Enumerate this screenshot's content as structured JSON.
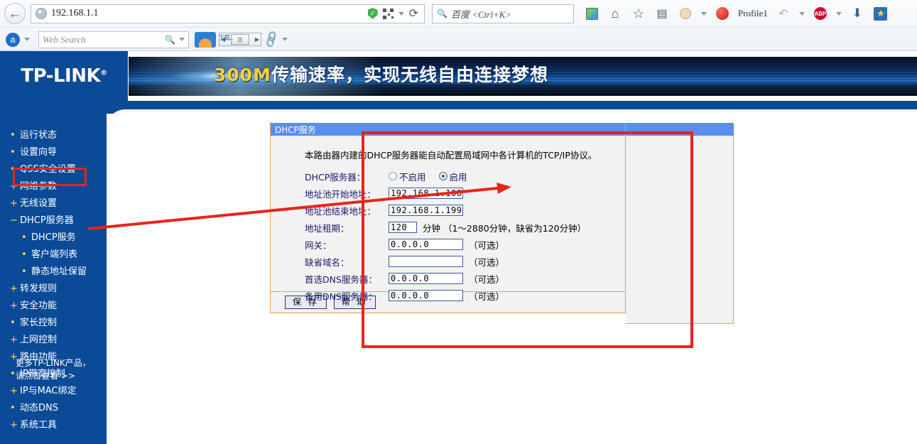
{
  "browser": {
    "back_icon": "back-arrow-icon",
    "url": "192.168.1.1",
    "url_shield_icon": "shield-check-icon",
    "url_qr_icon": "qr-code-icon",
    "url_dropdown_icon": "chevron-down-icon",
    "reload_icon": "reload-icon",
    "search_placeholder": "百度 <Ctrl+K>",
    "search_icon": "search-icon",
    "toolbar": {
      "translate_icon": "translate-icon",
      "home_icon": "home-icon",
      "bookmark_star_icon": "star-icon",
      "reading_list_icon": "document-icon",
      "avatar_icon": "face-icon",
      "overflow_caret_icon": "chevron-down-icon",
      "tomato_icon": "tomato-timer-icon",
      "profile_label": "Profile1",
      "undo_icon": "undo-icon",
      "undo_caret_icon": "chevron-down-icon",
      "adblock_label": "ABP",
      "adblock_caret_icon": "chevron-down-icon",
      "download_icon": "download-icon",
      "favorites_icon": "star-favorites-icon"
    },
    "extension_bar": {
      "alexa_label": "a",
      "alexa_caret_icon": "chevron-down-icon",
      "web_search_placeholder": "Web Search",
      "web_search_icon": "search-icon",
      "web_search_caret_icon": "chevron-down-icon",
      "mini_label": "下载...",
      "scroll_left_icon": "left-arrow-icon",
      "scroll_thumb_icon": "grip-icon",
      "scroll_right_icon": "right-arrow-icon",
      "chain_icon": "link-chain-icon",
      "chain_caret_icon": "chevron-down-icon"
    }
  },
  "router": {
    "logo": "TP-LINK",
    "logo_mark": "®",
    "banner_highlight": "300M",
    "banner_text": "传输速率，实现无线自由连接梦想",
    "sidebar": {
      "items": [
        {
          "mark": "•",
          "label": "运行状态",
          "level": 0
        },
        {
          "mark": "•",
          "label": "设置向导",
          "level": 0
        },
        {
          "mark": "•",
          "label": "QSS安全设置",
          "level": 0
        },
        {
          "mark": "+",
          "label": "网络参数",
          "level": 0
        },
        {
          "mark": "+",
          "label": "无线设置",
          "level": 0
        },
        {
          "mark": "−",
          "label": "DHCP服务器",
          "level": 0
        },
        {
          "mark": "•",
          "label": "DHCP服务",
          "level": 1
        },
        {
          "mark": "•",
          "label": "客户端列表",
          "level": 1
        },
        {
          "mark": "•",
          "label": "静态地址保留",
          "level": 1
        },
        {
          "mark": "+",
          "label": "转发规则",
          "level": 0
        },
        {
          "mark": "+",
          "label": "安全功能",
          "level": 0
        },
        {
          "mark": "•",
          "label": "家长控制",
          "level": 0
        },
        {
          "mark": "+",
          "label": "上网控制",
          "level": 0
        },
        {
          "mark": "+",
          "label": "路由功能",
          "level": 0
        },
        {
          "mark": "•",
          "label": "IP带宽控制",
          "level": 0
        },
        {
          "mark": "+",
          "label": "IP与MAC绑定",
          "level": 0
        },
        {
          "mark": "•",
          "label": "动态DNS",
          "level": 0
        },
        {
          "mark": "+",
          "label": "系统工具",
          "level": 0
        }
      ],
      "footer_line1": "更多TP-LINK产品，",
      "footer_line2": "请点击查看 >>"
    },
    "panel": {
      "title": "DHCP服务",
      "description": "本路由器内建的DHCP服务器能自动配置局域网中各计算机的TCP/IP协议。",
      "dhcp_server_label": "DHCP服务器：",
      "radio_disable_label": "不启用",
      "radio_enable_label": "启用",
      "radio_selected": "启用",
      "fields": [
        {
          "label": "地址池开始地址：",
          "value": "192.168.1.100",
          "note": "",
          "width": "ip"
        },
        {
          "label": "地址池结束地址：",
          "value": "192.168.1.199",
          "note": "",
          "width": "ip"
        },
        {
          "label": "地址租期：",
          "value": "120",
          "note": "分钟 （1～2880分钟，缺省为120分钟）",
          "width": "lease"
        },
        {
          "label": "网关：",
          "value": "0.0.0.0",
          "note": "（可选）",
          "width": "ip"
        },
        {
          "label": "缺省域名：",
          "value": "",
          "note": "（可选）",
          "width": "ip"
        },
        {
          "label": "首选DNS服务器：",
          "value": "0.0.0.0",
          "note": "（可选）",
          "width": "ip"
        },
        {
          "label": "备用DNS服务器：",
          "value": "0.0.0.0",
          "note": "（可选）",
          "width": "ip"
        }
      ],
      "save_button": "保 存",
      "help_button": "帮 助"
    }
  },
  "annotation": {
    "highlight_color": "#e8241c",
    "arrow_color": "#e8241c",
    "sidebar_box_target": "DHCP服务",
    "panel_box_target": "DHCP服务"
  }
}
